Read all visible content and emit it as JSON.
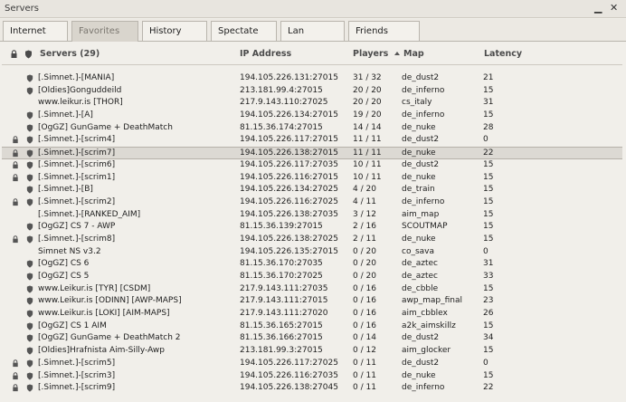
{
  "window": {
    "title": "Servers",
    "minimize_icon": "minimize-icon",
    "close_icon": "close-icon"
  },
  "tabs": [
    {
      "label": "Internet",
      "active": false
    },
    {
      "label": "Favorites",
      "active": true
    },
    {
      "label": "History",
      "active": false
    },
    {
      "label": "Spectate",
      "active": false
    },
    {
      "label": "Lan",
      "active": false
    },
    {
      "label": "Friends",
      "active": false
    }
  ],
  "columns": {
    "servers": "Servers (29)",
    "ip": "IP Address",
    "players": "Players",
    "map": "Map",
    "latency": "Latency",
    "lock_icon": "lock-icon",
    "vac_icon": "shield-icon",
    "sort_icon": "sort-ascending-icon"
  },
  "rows": [
    {
      "name": "[.Simnet.]-[MANIA]",
      "ip": "194.105.226.131:27015",
      "players": "31 / 32",
      "map": "de_dust2",
      "latency": "21",
      "locked": false,
      "vac": true,
      "selected": false
    },
    {
      "name": "[Oldies]Gonguddeild",
      "ip": "213.181.99.4:27015",
      "players": "20 / 20",
      "map": "de_inferno",
      "latency": "15",
      "locked": false,
      "vac": true,
      "selected": false
    },
    {
      "name": "www.leikur.is [THOR]",
      "ip": "217.9.143.110:27025",
      "players": "20 / 20",
      "map": "cs_italy",
      "latency": "31",
      "locked": false,
      "vac": false,
      "selected": false
    },
    {
      "name": "[.Simnet.]-[A]",
      "ip": "194.105.226.134:27015",
      "players": "19 / 20",
      "map": "de_inferno",
      "latency": "15",
      "locked": false,
      "vac": true,
      "selected": false
    },
    {
      "name": "[OgGZ] GunGame + DeathMatch",
      "ip": "81.15.36.174:27015",
      "players": "14 / 14",
      "map": "de_nuke",
      "latency": "28",
      "locked": false,
      "vac": true,
      "selected": false
    },
    {
      "name": "[.Simnet.]-[scrim4]",
      "ip": "194.105.226.117:27015",
      "players": "11 / 11",
      "map": "de_dust2",
      "latency": "0",
      "locked": true,
      "vac": true,
      "selected": false
    },
    {
      "name": "[.Simnet.]-[scrim7]",
      "ip": "194.105.226.138:27015",
      "players": "11 / 11",
      "map": "de_nuke",
      "latency": "22",
      "locked": true,
      "vac": true,
      "selected": true
    },
    {
      "name": "[.Simnet.]-[scrim6]",
      "ip": "194.105.226.117:27035",
      "players": "10 / 11",
      "map": "de_dust2",
      "latency": "15",
      "locked": true,
      "vac": true,
      "selected": false
    },
    {
      "name": "[.Simnet.]-[scrim1]",
      "ip": "194.105.226.116:27015",
      "players": "10 / 11",
      "map": "de_nuke",
      "latency": "15",
      "locked": true,
      "vac": true,
      "selected": false
    },
    {
      "name": "[.Simnet.]-[B]",
      "ip": "194.105.226.134:27025",
      "players": "4 / 20",
      "map": "de_train",
      "latency": "15",
      "locked": false,
      "vac": true,
      "selected": false
    },
    {
      "name": "[.Simnet.]-[scrim2]",
      "ip": "194.105.226.116:27025",
      "players": "4 / 11",
      "map": "de_inferno",
      "latency": "15",
      "locked": true,
      "vac": true,
      "selected": false
    },
    {
      "name": "[.Simnet.]-[RANKED_AIM]",
      "ip": "194.105.226.138:27035",
      "players": "3 / 12",
      "map": "aim_map",
      "latency": "15",
      "locked": false,
      "vac": false,
      "selected": false
    },
    {
      "name": "[OgGZ] CS 7 - AWP",
      "ip": "81.15.36.139:27015",
      "players": "2 / 16",
      "map": "SCOUTMAP",
      "latency": "15",
      "locked": false,
      "vac": true,
      "selected": false
    },
    {
      "name": "[.Simnet.]-[scrim8]",
      "ip": "194.105.226.138:27025",
      "players": "2 / 11",
      "map": "de_nuke",
      "latency": "15",
      "locked": true,
      "vac": true,
      "selected": false
    },
    {
      "name": "Simnet NS v3.2",
      "ip": "194.105.226.135:27015",
      "players": "0 / 20",
      "map": "co_sava",
      "latency": "0",
      "locked": false,
      "vac": false,
      "selected": false
    },
    {
      "name": "[OgGZ] CS 6",
      "ip": "81.15.36.170:27035",
      "players": "0 / 20",
      "map": "de_aztec",
      "latency": "31",
      "locked": false,
      "vac": true,
      "selected": false
    },
    {
      "name": "[OgGZ] CS 5",
      "ip": "81.15.36.170:27025",
      "players": "0 / 20",
      "map": "de_aztec",
      "latency": "33",
      "locked": false,
      "vac": true,
      "selected": false
    },
    {
      "name": "www.Leikur.is [TYR] [CSDM]",
      "ip": "217.9.143.111:27035",
      "players": "0 / 16",
      "map": "de_cbble",
      "latency": "15",
      "locked": false,
      "vac": true,
      "selected": false
    },
    {
      "name": "www.Leikur.is [ODINN] [AWP-MAPS]",
      "ip": "217.9.143.111:27015",
      "players": "0 / 16",
      "map": "awp_map_final",
      "latency": "23",
      "locked": false,
      "vac": true,
      "selected": false
    },
    {
      "name": "www.Leikur.is [LOKI] [AIM-MAPS]",
      "ip": "217.9.143.111:27020",
      "players": "0 / 16",
      "map": "aim_cbblex",
      "latency": "26",
      "locked": false,
      "vac": true,
      "selected": false
    },
    {
      "name": "[OgGZ] CS 1 AIM",
      "ip": "81.15.36.165:27015",
      "players": "0 / 16",
      "map": "a2k_aimskillz",
      "latency": "15",
      "locked": false,
      "vac": true,
      "selected": false
    },
    {
      "name": "[OgGZ] GunGame + DeathMatch 2",
      "ip": "81.15.36.166:27015",
      "players": "0 / 14",
      "map": "de_dust2",
      "latency": "34",
      "locked": false,
      "vac": true,
      "selected": false
    },
    {
      "name": "[Oldies]Hrafnista Aim-Silly-Awp",
      "ip": "213.181.99.3:27015",
      "players": "0 / 12",
      "map": "aim_glocker",
      "latency": "15",
      "locked": false,
      "vac": true,
      "selected": false
    },
    {
      "name": "[.Simnet.]-[scrim5]",
      "ip": "194.105.226.117:27025",
      "players": "0 / 11",
      "map": "de_dust2",
      "latency": "0",
      "locked": true,
      "vac": true,
      "selected": false
    },
    {
      "name": "[.Simnet.]-[scrim3]",
      "ip": "194.105.226.116:27035",
      "players": "0 / 11",
      "map": "de_nuke",
      "latency": "15",
      "locked": true,
      "vac": true,
      "selected": false
    },
    {
      "name": "[.Simnet.]-[scrim9]",
      "ip": "194.105.226.138:27045",
      "players": "0 / 11",
      "map": "de_inferno",
      "latency": "22",
      "locked": true,
      "vac": true,
      "selected": false
    }
  ]
}
